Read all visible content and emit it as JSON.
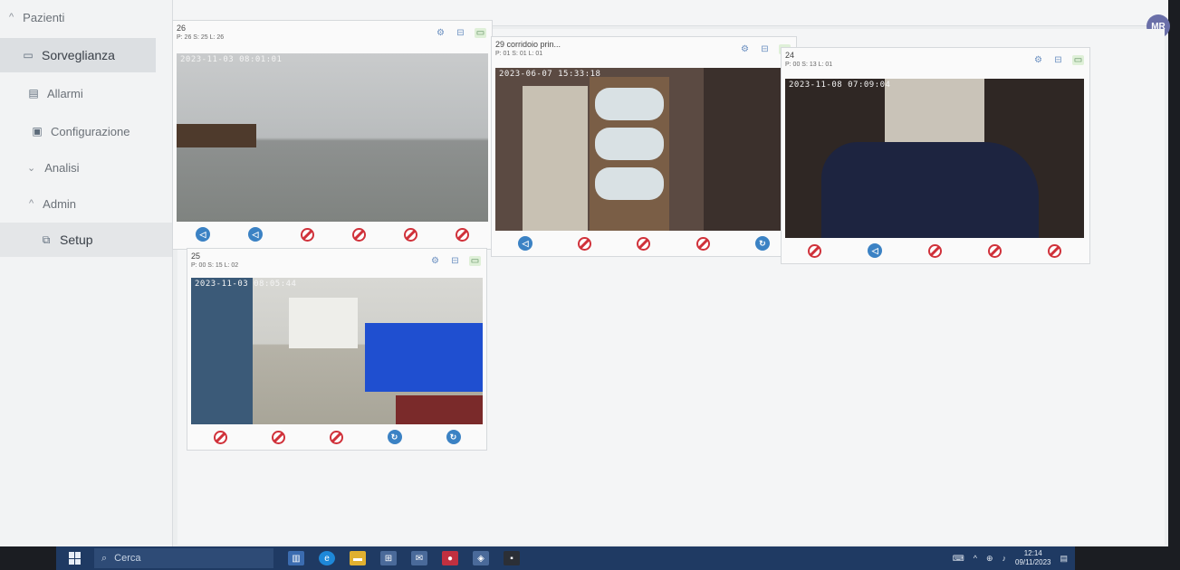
{
  "sidebar": {
    "items": [
      {
        "label": "Pazienti",
        "icon": "chevron-up-icon"
      },
      {
        "label": "Sorveglianza",
        "icon": "monitor-icon",
        "active": true
      },
      {
        "label": "Allarmi",
        "icon": "clipboard-icon"
      },
      {
        "label": "Configurazione",
        "icon": "window-icon"
      },
      {
        "label": "Analisi",
        "icon": "chevron-down-icon"
      },
      {
        "label": "Admin",
        "icon": "chevron-up-icon"
      },
      {
        "label": "Setup",
        "icon": "setup-icon"
      }
    ]
  },
  "user": {
    "initials": "MR"
  },
  "cameras": [
    {
      "title": "26",
      "info": "P: 26 S: 25 L: 26",
      "timestamp": "2023-11-03 08:01:01",
      "controls": [
        "blue",
        "blue",
        "no",
        "no",
        "no",
        "no"
      ]
    },
    {
      "title": "29 corridoio prin...",
      "info": "P: 01 S: 01 L: 01",
      "timestamp": "2023-06-07 15:33:18",
      "controls": [
        "blue",
        "no",
        "no",
        "no",
        "blue"
      ]
    },
    {
      "title": "24",
      "info": "P: 00 S: 13 L: 01",
      "timestamp": "2023-11-08 07:09:04",
      "controls": [
        "no",
        "blue",
        "no",
        "no",
        "no"
      ]
    },
    {
      "title": "25",
      "info": "P: 00 S: 15 L: 02",
      "timestamp": "2023-11-03 08:05:44",
      "controls": [
        "no",
        "no",
        "no",
        "blue",
        "blue"
      ]
    }
  ],
  "taskbar": {
    "search_placeholder": "Cerca",
    "time": "12:14",
    "date": "09/11/2023"
  },
  "colors": {
    "accent": "#3b82c4",
    "stop": "#d0313a",
    "taskbar": "#1f3a63"
  }
}
